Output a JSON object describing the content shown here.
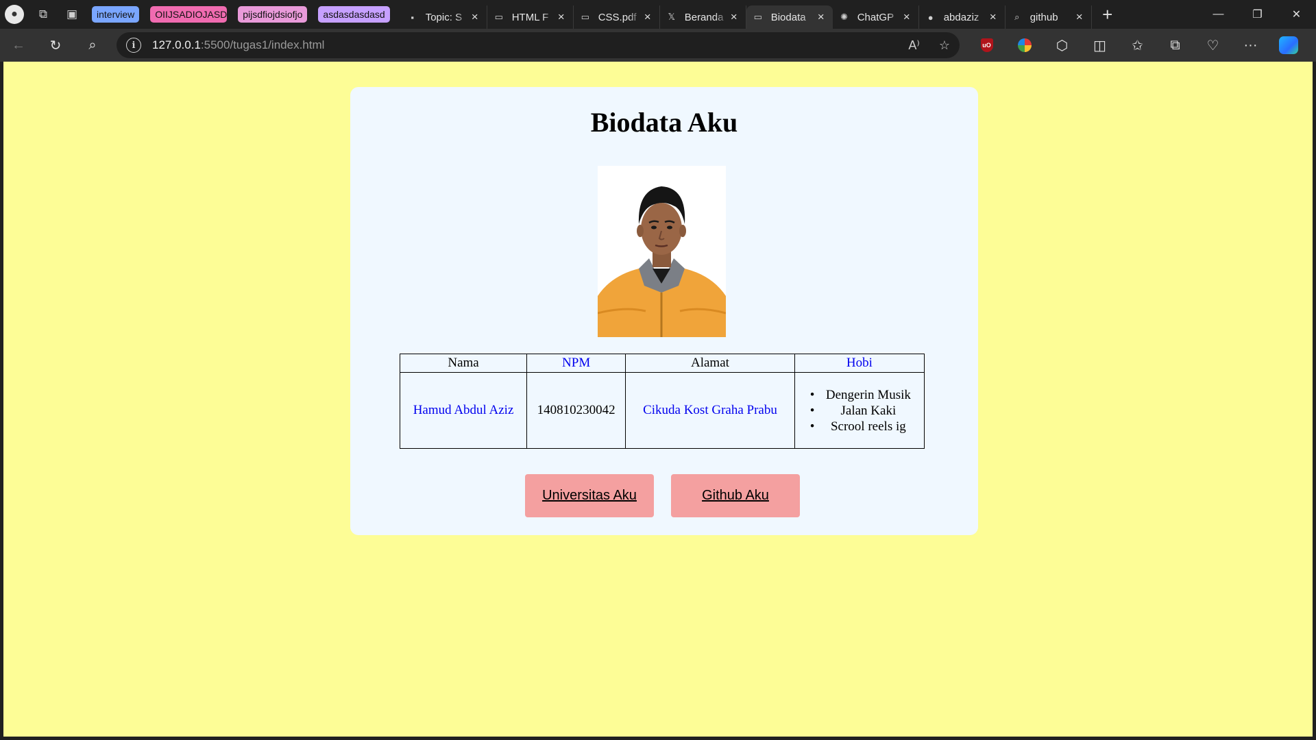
{
  "browser": {
    "tab_groups": [
      {
        "label": "interview",
        "color": "#7aa6ff"
      },
      {
        "label": "OIIJSADIOJASD",
        "color": "#f06bb0"
      },
      {
        "label": "pijsdfiojdsiofjo",
        "color": "#e99ad9"
      },
      {
        "label": "asdasdasdasd",
        "color": "#c6a0ff"
      }
    ],
    "tabs": [
      {
        "title": "Topic: S",
        "icon": "live-icon",
        "glyph": "▪"
      },
      {
        "title": "HTML F",
        "icon": "document-icon",
        "glyph": "▭"
      },
      {
        "title": "CSS.pdf",
        "icon": "document-icon",
        "glyph": "▭"
      },
      {
        "title": "Beranda",
        "icon": "x-logo-icon",
        "glyph": "𝕏"
      },
      {
        "title": "Biodata",
        "icon": "document-icon",
        "glyph": "▭",
        "active": true
      },
      {
        "title": "ChatGP",
        "icon": "chatgpt-icon",
        "glyph": "✺"
      },
      {
        "title": "abdaziz",
        "icon": "github-icon",
        "glyph": "●"
      },
      {
        "title": "github",
        "icon": "search-icon",
        "glyph": "⌕"
      }
    ],
    "url": {
      "host": "127.0.0.1",
      "path": ":5500/tugas1/index.html"
    }
  },
  "page": {
    "title": "Biodata Aku",
    "photo_alt": "Foto",
    "table": {
      "headers": [
        "Nama",
        "NPM",
        "Alamat",
        "Hobi"
      ],
      "row": {
        "nama": "Hamud Abdul Aziz",
        "npm": "140810230042",
        "alamat": "Cikuda Kost Graha Prabu",
        "hobi": [
          "Dengerin Musik",
          "Jalan Kaki",
          "Scrool reels ig"
        ]
      }
    },
    "buttons": {
      "universitas": "Universitas Aku",
      "github": "Github Aku"
    }
  },
  "colors": {
    "page_background": "#fdfd96",
    "card_background": "#f0f8ff",
    "button_background": "#f4a0a0",
    "link_blue": "#0000ee"
  }
}
